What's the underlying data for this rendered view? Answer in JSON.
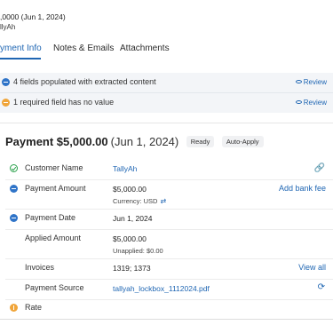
{
  "header": {
    "subtitle_line1": ",0000 (Jun 1, 2024)",
    "subtitle_line2": "llyAh"
  },
  "tabs": [
    {
      "label": "yment Info",
      "active": true
    },
    {
      "label": "Notes & Emails",
      "active": false
    },
    {
      "label": "Attachments",
      "active": false
    }
  ],
  "alerts": [
    {
      "text": "4 fields populated with extracted content",
      "action": "Review",
      "color": "#2f74c8"
    },
    {
      "text": "1 required field has no value",
      "action": "Review",
      "color": "#f0a53a"
    }
  ],
  "payment": {
    "title": "Payment $5,000.00",
    "date": "(Jun 1, 2024)",
    "badges": [
      "Ready",
      "Auto-Apply"
    ]
  },
  "fields": [
    {
      "label": "Customer Name",
      "value": "TallyAh",
      "status": "check",
      "action_icon": "link-icon"
    },
    {
      "label": "Payment Amount",
      "value": "$5,000.00",
      "sub": "Currency: USD",
      "status": "extracted",
      "action": "Add bank fee"
    },
    {
      "label": "Payment Date",
      "value": "Jun 1, 2024",
      "status": "extracted"
    },
    {
      "label": "Applied Amount",
      "value": "$5,000.00",
      "sub": "Unapplied: $0.00"
    },
    {
      "label": "Invoices",
      "value": "1319; 1373",
      "action": "View all"
    },
    {
      "label": "Payment Source",
      "value": "tallyah_lockbox_1112024.pdf",
      "action_icon": "refresh-icon"
    },
    {
      "label": "Rate",
      "value": "",
      "status": "missing"
    }
  ],
  "colors": {
    "accent": "#1f66b3",
    "extracted": "#2f74c8",
    "missing": "#f0a53a",
    "ok": "#2aa14b"
  }
}
